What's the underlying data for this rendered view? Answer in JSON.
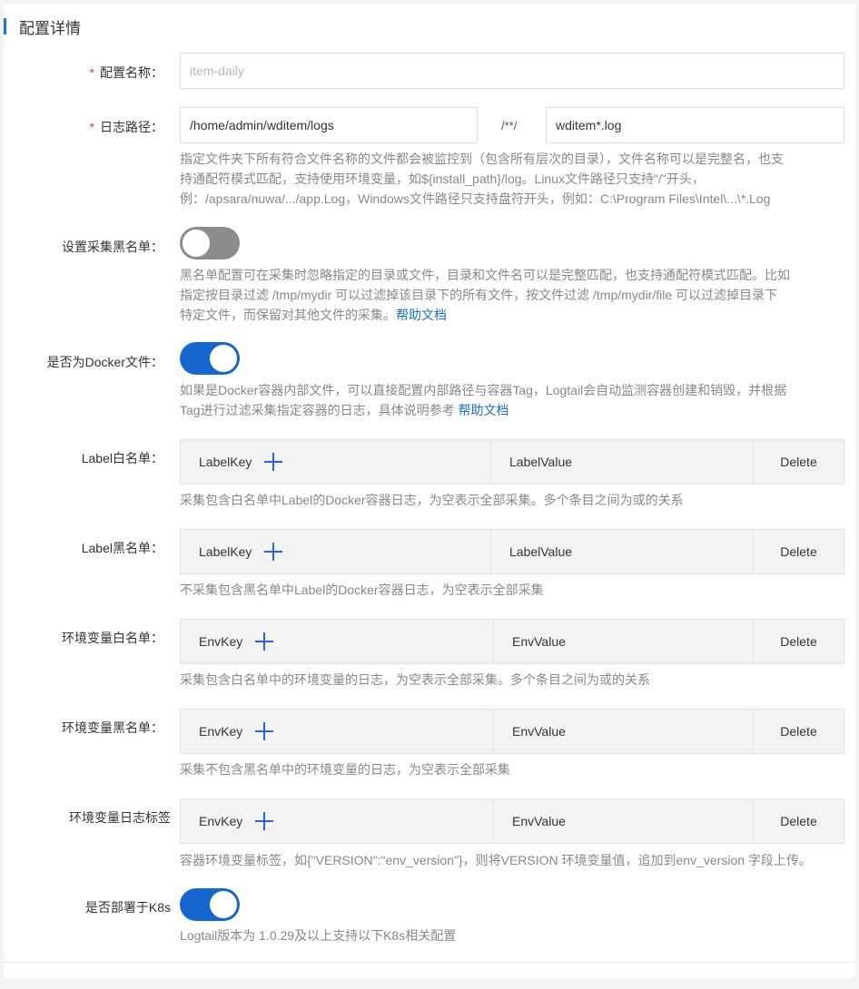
{
  "section_title": "配置详情",
  "config_name": {
    "label": "配置名称：",
    "placeholder": "item-daily"
  },
  "log_path": {
    "label": "日志路径：",
    "dir_value": "/home/admin/wditem/logs",
    "separator": "/**/",
    "file_value": "wditem*.log",
    "help_line1": "指定文件夹下所有符合文件名称的文件都会被监控到（包含所有层次的目录），文件名称可以是完整名，也支",
    "help_line2": "持通配符模式匹配，支持使用环境变量，如${install_path}/log。Linux文件路径只支持\"/\"开头，",
    "help_line3": "例：/apsara/nuwa/.../app.Log，Windows文件路径只支持盘符开头，例如：C:\\Program Files\\Intel\\...\\*.Log"
  },
  "blacklist": {
    "label": "设置采集黑名单：",
    "enabled": false,
    "help_line1": "黑名单配置可在采集时忽略指定的目录或文件，目录和文件名可以是完整匹配，也支持通配符模式匹配。比如",
    "help_line2": "指定按目录过滤 /tmp/mydir 可以过滤掉该目录下的所有文件，按文件过滤 /tmp/mydir/file 可以过滤掉目录下",
    "help_line3": "特定文件，而保留对其他文件的采集。",
    "help_link": "帮助文档"
  },
  "docker": {
    "label": "是否为Docker文件：",
    "enabled": true,
    "help_line1": "如果是Docker容器内部文件，可以直接配置内部路径与容器Tag，Logtail会自动监测容器创建和销毁，并根据",
    "help_line2": "Tag进行过滤采集指定容器的日志，具体说明参考 ",
    "help_link": "帮助文档"
  },
  "label_whitelist": {
    "label": "Label白名单：",
    "col_key": "LabelKey",
    "col_value": "LabelValue",
    "col_delete": "Delete",
    "help": "采集包含白名单中Label的Docker容器日志，为空表示全部采集。多个条目之间为或的关系"
  },
  "label_blacklist": {
    "label": "Label黑名单：",
    "col_key": "LabelKey",
    "col_value": "LabelValue",
    "col_delete": "Delete",
    "help": "不采集包含黑名单中Label的Docker容器日志，为空表示全部采集"
  },
  "env_whitelist": {
    "label": "环境变量白名单：",
    "col_key": "EnvKey",
    "col_value": "EnvValue",
    "col_delete": "Delete",
    "help": "采集包含白名单中的环境变量的日志，为空表示全部采集。多个条目之间为或的关系"
  },
  "env_blacklist": {
    "label": "环境变量黑名单：",
    "col_key": "EnvKey",
    "col_value": "EnvValue",
    "col_delete": "Delete",
    "help": "采集不包含黑名单中的环境变量的日志，为空表示全部采集"
  },
  "env_tags": {
    "label": "环境变量日志标签",
    "col_key": "EnvKey",
    "col_value": "EnvValue",
    "col_delete": "Delete",
    "help": "容器环境变量标签，如{\"VERSION\":\"env_version\"}，则将VERSION 环境变量值，追加到env_version 字段上传。"
  },
  "k8s": {
    "label": "是否部署于K8s",
    "enabled": true,
    "help": "Logtail版本为 1.0.29及以上支持以下K8s相关配置"
  },
  "colors": {
    "accent": "#1a78dc",
    "toggle_on": "#1666cf",
    "toggle_off": "#8c8c8c",
    "link": "#1a6fd3",
    "required": "#e23b3b"
  }
}
